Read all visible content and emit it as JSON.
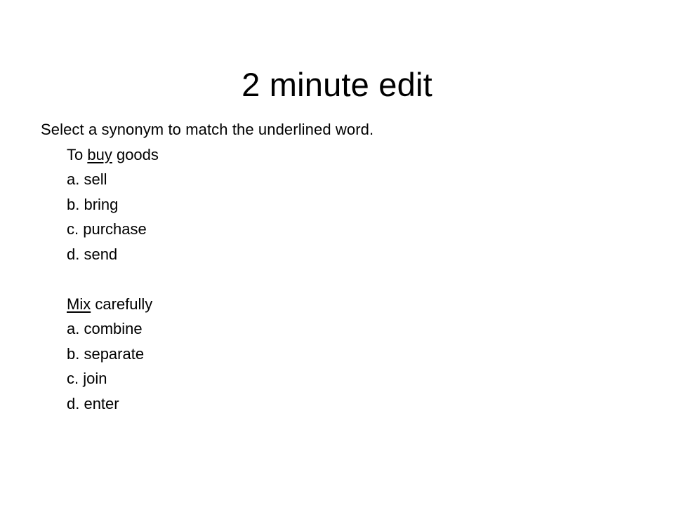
{
  "slide": {
    "title": "2 minute edit",
    "instruction": "Select a synonym to match the underlined word.",
    "questions": [
      {
        "prompt_before": "To ",
        "underlined_word": "buy",
        "prompt_after": " goods",
        "options": [
          "a. sell",
          "b. bring",
          "c. purchase",
          "d. send"
        ]
      },
      {
        "prompt_before": "",
        "underlined_word": "Mix",
        "prompt_after": " carefully",
        "options": [
          "a. combine",
          "b. separate",
          "c. join",
          "d. enter"
        ]
      }
    ]
  }
}
